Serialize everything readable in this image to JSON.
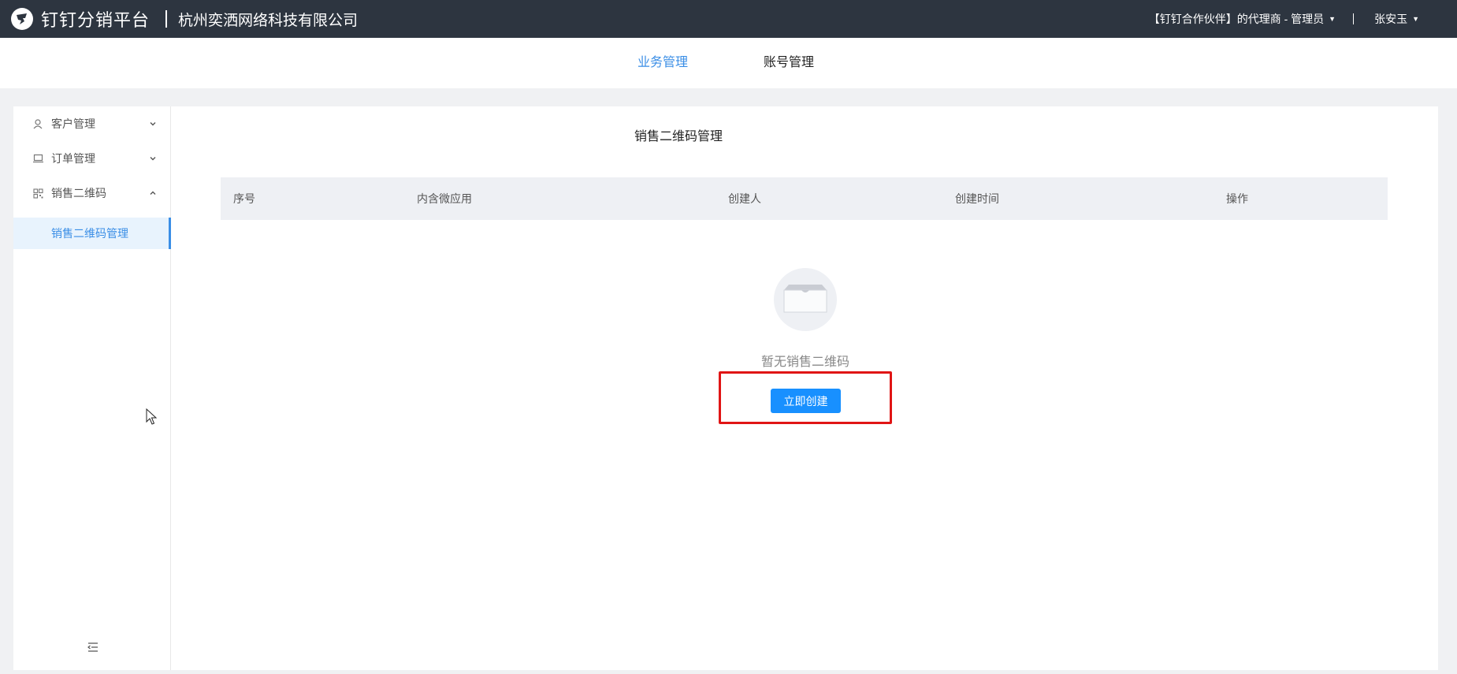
{
  "header": {
    "app_name": "钉钉分销平台",
    "company": "杭州奕洒网络科技有限公司",
    "role": "【钉钉合作伙伴】的代理商 - 管理员",
    "user": "张安玉"
  },
  "nav": {
    "tabs": [
      {
        "label": "业务管理",
        "active": true
      },
      {
        "label": "账号管理",
        "active": false
      }
    ]
  },
  "sidebar": {
    "items": [
      {
        "label": "客户管理",
        "icon": "user-icon",
        "expanded": false
      },
      {
        "label": "订单管理",
        "icon": "laptop-icon",
        "expanded": false
      },
      {
        "label": "销售二维码",
        "icon": "qrcode-icon",
        "expanded": true
      }
    ],
    "submenu": {
      "label": "销售二维码管理"
    }
  },
  "main": {
    "title": "销售二维码管理",
    "columns": [
      "序号",
      "内含微应用",
      "创建人",
      "创建时间",
      "操作"
    ],
    "empty_text": "暂无销售二维码",
    "create_button": "立即创建"
  },
  "colors": {
    "topbar": "#2d3540",
    "accent": "#3a8ee6",
    "button": "#1890ff",
    "highlight": "#e01515"
  }
}
